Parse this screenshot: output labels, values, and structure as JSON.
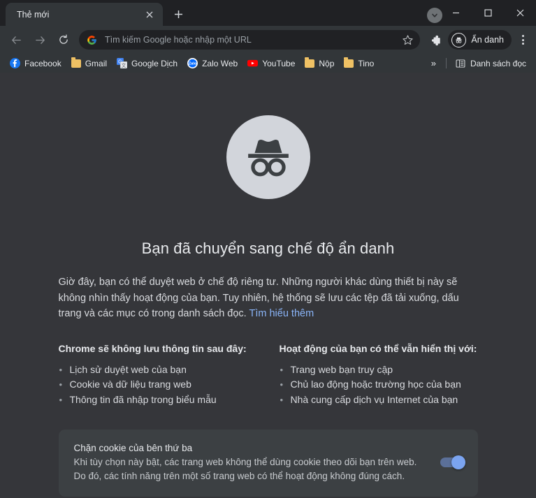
{
  "window": {
    "minimize_label": "Minimize",
    "maximize_label": "Maximize",
    "close_label": "Close"
  },
  "tabstrip": {
    "active_tab": "Thẻ mới",
    "new_tab_label": "+",
    "tab_search_label": "Tìm kiếm thẻ"
  },
  "toolbar": {
    "back_label": "Quay lại",
    "forward_label": "Chuyển tiếp",
    "reload_label": "Tải lại",
    "omnibox_placeholder": "Tìm kiếm Google hoặc nhập một URL",
    "bookmark_star_label": "Đánh dấu trang này",
    "extensions_label": "Tiện ích",
    "incognito_label": "Ẩn danh",
    "menu_label": "Tuỳ chỉnh và kiểm soát Google Chrome"
  },
  "bookmarks": {
    "items": [
      {
        "label": "Facebook",
        "icon": "facebook-icon"
      },
      {
        "label": "Gmail",
        "icon": "folder-icon"
      },
      {
        "label": "Google Dịch",
        "icon": "google-translate-icon"
      },
      {
        "label": "Zalo Web",
        "icon": "zalo-icon"
      },
      {
        "label": "YouTube",
        "icon": "youtube-icon"
      },
      {
        "label": "Nộp",
        "icon": "folder-icon"
      },
      {
        "label": "Tino",
        "icon": "folder-icon"
      }
    ],
    "overflow_label": "»",
    "reading_list_label": "Danh sách đọc"
  },
  "page": {
    "hero_icon": "incognito-spy-icon",
    "title": "Bạn đã chuyển sang chế độ ẩn danh",
    "intro": "Giờ đây, bạn có thể duyệt web ở chế độ riêng tư. Những người khác dùng thiết bị này sẽ không nhìn thấy hoạt động của bạn. Tuy nhiên, hệ thống sẽ lưu các tệp đã tải xuống, dấu trang và các mục có trong danh sách đọc.",
    "learn_more": "Tìm hiểu thêm",
    "columns": [
      {
        "heading": "Chrome sẽ không lưu thông tin sau đây:",
        "items": [
          "Lịch sử duyệt web của bạn",
          "Cookie và dữ liệu trang web",
          "Thông tin đã nhập trong biểu mẫu"
        ]
      },
      {
        "heading": "Hoạt động của bạn có thể vẫn hiển thị với:",
        "items": [
          "Trang web bạn truy cập",
          "Chủ lao động hoặc trường học của bạn",
          "Nhà cung cấp dịch vụ Internet của bạn"
        ]
      }
    ],
    "cookie_card": {
      "title": "Chặn cookie của bên thứ ba",
      "desc_line1": "Khi tùy chọn này bật, các trang web không thể dùng cookie theo dõi bạn trên web.",
      "desc_line2": "Do đó, các tính năng trên một số trang web có thể hoạt động không đúng cách.",
      "toggle_state": "on",
      "toggle_label": "Chặn cookie của bên thứ ba"
    }
  },
  "colors": {
    "page_bg": "#35363A",
    "chrome_bg": "#323639",
    "titlebar_bg": "#202124",
    "link": "#8AB4F8",
    "card_bg": "#3C4043",
    "toggle_on": "#7BA4F0"
  }
}
